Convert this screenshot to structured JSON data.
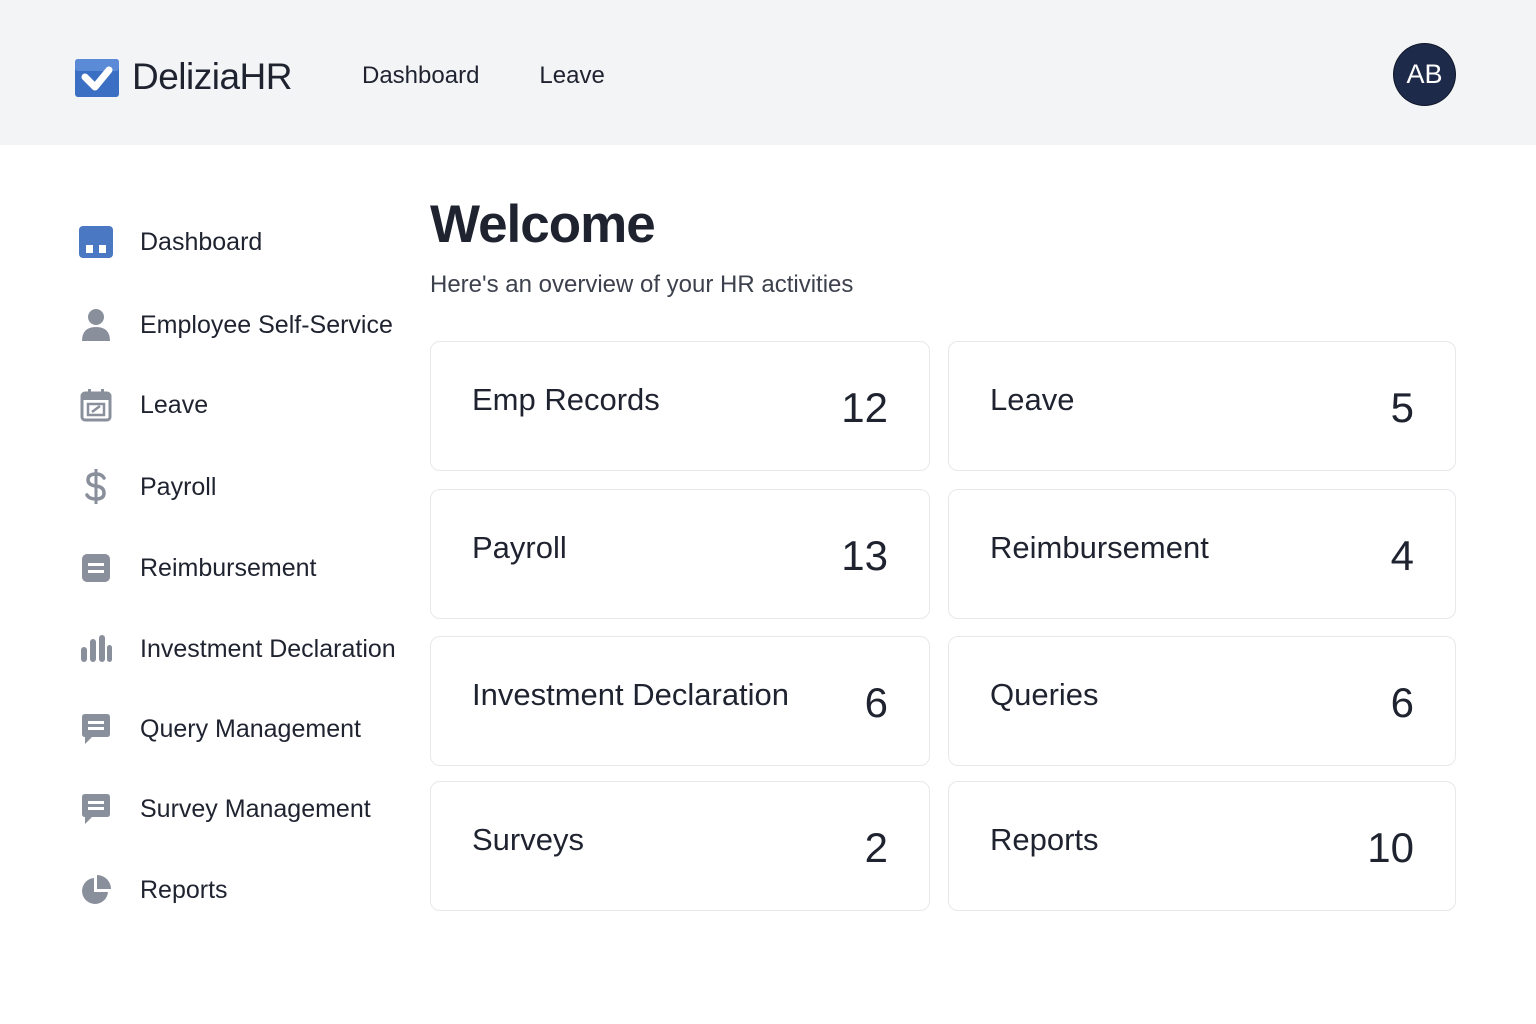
{
  "brand": {
    "name": "DeliziaHR",
    "logo_icon": "check-badge-icon",
    "accent": "#3b6fc4"
  },
  "topnav": {
    "items": [
      "Dashboard",
      "Leave"
    ]
  },
  "user": {
    "initials": "AB",
    "avatar_color": "#1e2a4a"
  },
  "sidebar": {
    "items": [
      {
        "label": "Dashboard",
        "icon": "dashboard-icon"
      },
      {
        "label": "Employee Self-Service",
        "icon": "person-icon"
      },
      {
        "label": "Leave",
        "icon": "calendar-icon"
      },
      {
        "label": "Payroll",
        "icon": "dollar-icon"
      },
      {
        "label": "Reimbursement",
        "icon": "document-icon"
      },
      {
        "label": "Investment Declaration",
        "icon": "bar-chart-icon"
      },
      {
        "label": "Query Management",
        "icon": "chat-icon"
      },
      {
        "label": "Survey Management",
        "icon": "chat-icon"
      },
      {
        "label": "Reports",
        "icon": "pie-chart-icon"
      }
    ]
  },
  "main": {
    "title": "Welcome",
    "subtitle": "Here's an overview of your HR activities",
    "cards": [
      {
        "label": "Emp Records",
        "value": "12"
      },
      {
        "label": "Leave",
        "value": "5"
      },
      {
        "label": "Payroll",
        "value": "13"
      },
      {
        "label": "Reimbursement",
        "value": "4"
      },
      {
        "label": "Investment Declaration",
        "value": "6"
      },
      {
        "label": "Queries",
        "value": "6"
      },
      {
        "label": "Surveys",
        "value": "2"
      },
      {
        "label": "Reports",
        "value": "10"
      }
    ]
  }
}
